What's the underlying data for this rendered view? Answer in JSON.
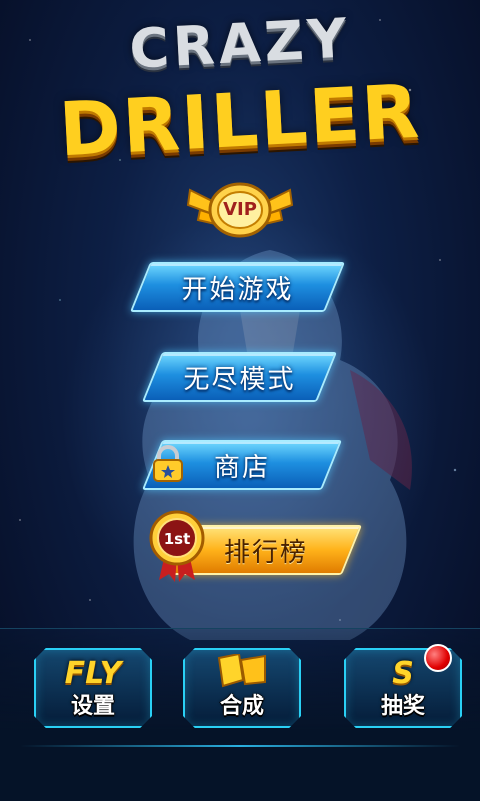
{
  "title": {
    "line1": "CRAZY",
    "line2": "DRILLER"
  },
  "vip": {
    "label": "VIP"
  },
  "menu": {
    "start": "开始游戏",
    "endless": "无尽模式",
    "shop": "商店",
    "leaderboard": "排行榜"
  },
  "medal": {
    "label": "1st"
  },
  "bottom": {
    "settings": {
      "icon": "FLY",
      "label": "设置"
    },
    "merge": {
      "label": "合成"
    },
    "lottery": {
      "icon": "S",
      "label": "抽奖"
    }
  }
}
